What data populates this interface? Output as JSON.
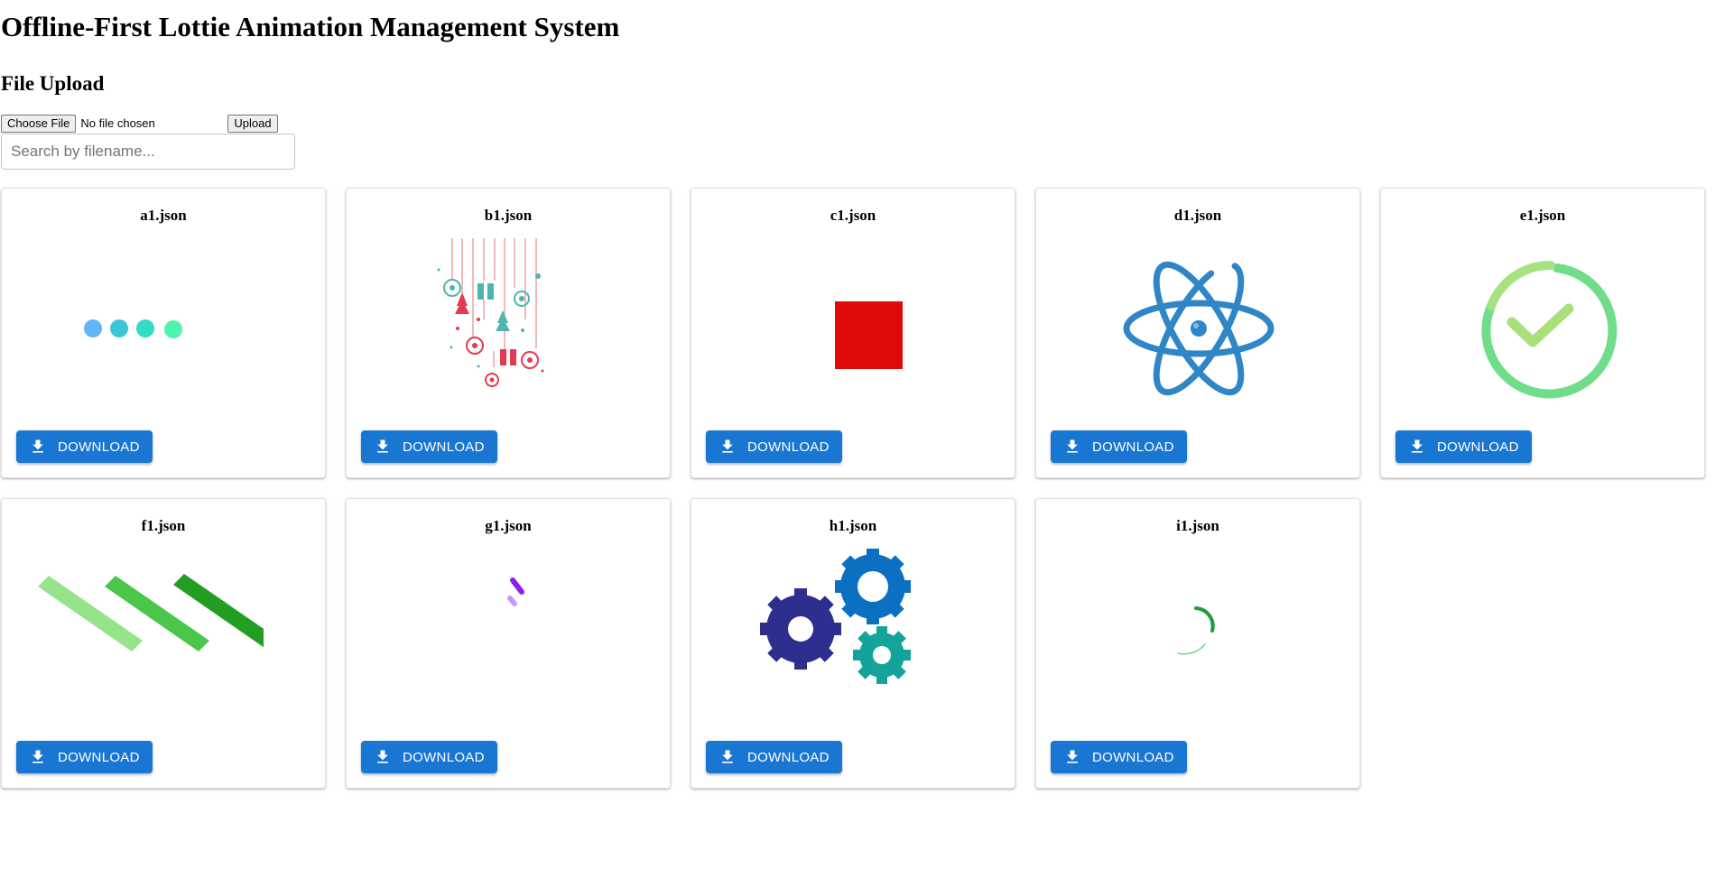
{
  "header": {
    "title": "Offline-First Lottie Animation Management System",
    "upload_heading": "File Upload"
  },
  "upload": {
    "choose_label": "Choose File",
    "file_status": "No file chosen",
    "upload_label": "Upload"
  },
  "search": {
    "placeholder": "Search by filename...",
    "value": ""
  },
  "colors": {
    "button": "#1976d2",
    "button_text": "#ffffff"
  },
  "cards": [
    {
      "filename": "a1.json",
      "download_label": "DOWNLOAD",
      "preview": "four-dots-loader"
    },
    {
      "filename": "b1.json",
      "download_label": "DOWNLOAD",
      "preview": "christmas-ornaments"
    },
    {
      "filename": "c1.json",
      "download_label": "DOWNLOAD",
      "preview": "red-square"
    },
    {
      "filename": "d1.json",
      "download_label": "DOWNLOAD",
      "preview": "atom-icon"
    },
    {
      "filename": "e1.json",
      "download_label": "DOWNLOAD",
      "preview": "checkmark-circle"
    },
    {
      "filename": "f1.json",
      "download_label": "DOWNLOAD",
      "preview": "green-stripes"
    },
    {
      "filename": "g1.json",
      "download_label": "DOWNLOAD",
      "preview": "purple-spinner"
    },
    {
      "filename": "h1.json",
      "download_label": "DOWNLOAD",
      "preview": "gears"
    },
    {
      "filename": "i1.json",
      "download_label": "DOWNLOAD",
      "preview": "green-arc-spinner"
    }
  ]
}
